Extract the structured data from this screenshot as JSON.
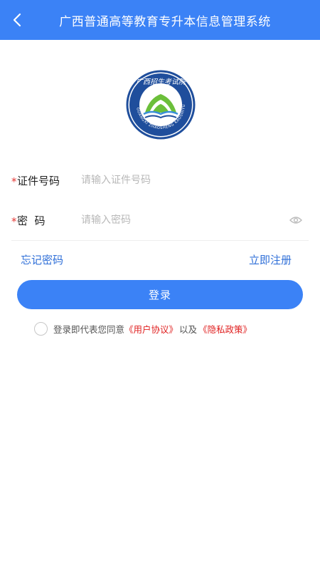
{
  "header": {
    "title": "广西普通高等教育专升本信息管理系统"
  },
  "logo": {
    "top_text": "广西招生考试院",
    "ring_text": "GUANGXI ZHAOSHENG KAOSHIYUAN",
    "colors": {
      "ring": "#1f4e9c",
      "leaf": "#6bbf3a",
      "water": "#3a8fd8"
    }
  },
  "form": {
    "id_number": {
      "required_mark": "*",
      "label": "证件号码",
      "value": "",
      "placeholder": "请输入证件号码"
    },
    "password": {
      "required_mark": "*",
      "label": "密  码",
      "value": "",
      "placeholder": "请输入密码"
    }
  },
  "links": {
    "forgot_password": "忘记密码",
    "register": "立即注册"
  },
  "login_button": "登录",
  "agreement": {
    "checked": false,
    "prefix": "登录即代表您同意",
    "user_agreement": "《用户协议》",
    "conjunction": "以及",
    "privacy_policy": "《隐私政策》"
  },
  "colors": {
    "primary": "#3b82f6",
    "link": "#2f6fd8",
    "required": "#e53935",
    "agreement_link": "#e02020"
  }
}
